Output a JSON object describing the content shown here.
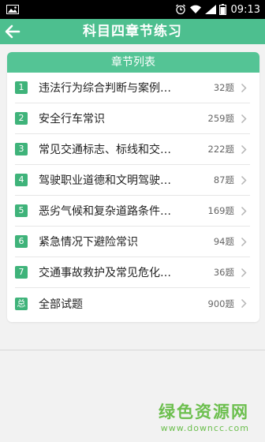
{
  "status": {
    "time": "09:13"
  },
  "appbar": {
    "title": "科目四章节练习"
  },
  "card": {
    "header": "章节列表",
    "items": [
      {
        "badge": "1",
        "title": "违法行为综合判断与案例…",
        "count": "32题"
      },
      {
        "badge": "2",
        "title": "安全行车常识",
        "count": "259题"
      },
      {
        "badge": "3",
        "title": "常见交通标志、标线和交…",
        "count": "222题"
      },
      {
        "badge": "4",
        "title": "驾驶职业道德和文明驾驶…",
        "count": "87题"
      },
      {
        "badge": "5",
        "title": "恶劣气候和复杂道路条件…",
        "count": "169题"
      },
      {
        "badge": "6",
        "title": "紧急情况下避险常识",
        "count": "94题"
      },
      {
        "badge": "7",
        "title": "交通事故救护及常见危化…",
        "count": "36题"
      },
      {
        "badge": "总",
        "title": "全部试题",
        "count": "900题"
      }
    ]
  },
  "watermark": {
    "main": "绿色资源网",
    "url": "www.downcc.com"
  },
  "colors": {
    "accent": "#4dbf8f",
    "badge": "#3fb37a",
    "header": "#54c495"
  }
}
